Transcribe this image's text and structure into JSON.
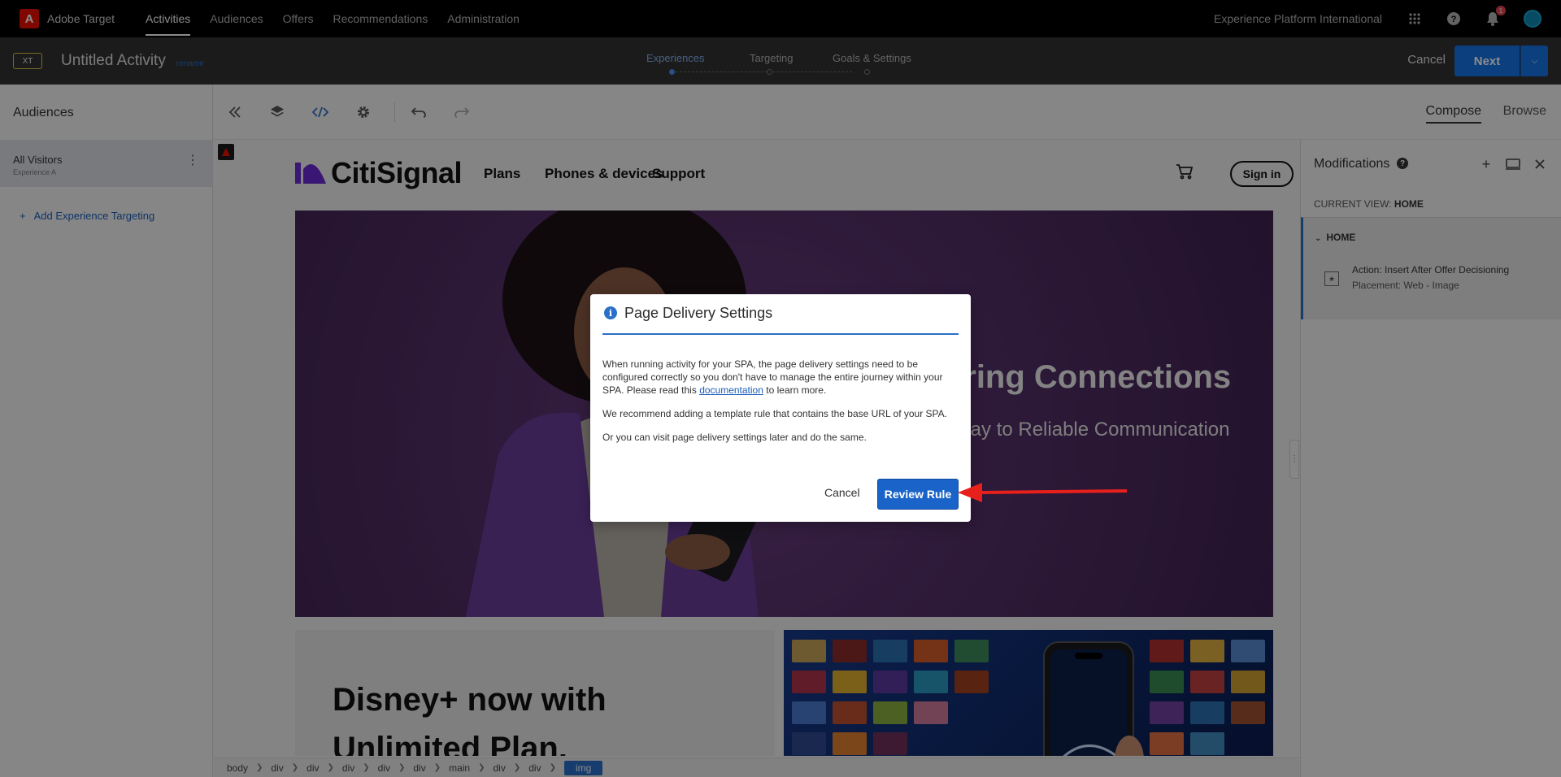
{
  "topnav": {
    "brand": "Adobe Target",
    "logo_letter": "A",
    "links": [
      "Activities",
      "Audiences",
      "Offers",
      "Recommendations",
      "Administration"
    ],
    "active_link": "Activities",
    "org": "Experience Platform International",
    "notification_count": "1"
  },
  "activity": {
    "badge": "XT",
    "title": "Untitled Activity",
    "rename": "rename",
    "steps": [
      "Experiences",
      "Targeting",
      "Goals & Settings"
    ],
    "active_step": "Experiences",
    "cancel_label": "Cancel",
    "next_label": "Next"
  },
  "left_panel": {
    "title": "Audiences",
    "audience_name": "All Visitors",
    "experience": "Experience A",
    "add_targeting": "Add Experience Targeting"
  },
  "toolbar": {
    "compose": "Compose",
    "browse": "Browse"
  },
  "site": {
    "logo": "CitiSignal",
    "nav": [
      "Plans",
      "Phones & devices",
      "Support"
    ],
    "signin": "Sign in",
    "hero_heading": "ering Connections",
    "hero_sub": "away to Reliable Communication",
    "promo_line1": "Disney+ now with",
    "promo_line2": "Unlimited Plan."
  },
  "right_panel": {
    "title": "Modifications",
    "current_view_label": "CURRENT VIEW:",
    "current_view": "HOME",
    "group": "HOME",
    "mod_action": "Action: Insert After Offer Decisioning",
    "mod_placement": "Placement: Web - Image"
  },
  "breadcrumb": [
    "body",
    "div",
    "div",
    "div",
    "div",
    "div",
    "main",
    "div",
    "div",
    "img"
  ],
  "dialog": {
    "title": "Page Delivery Settings",
    "para1_before": "When running activity for your SPA, the page delivery settings need to be configured correctly so you don't have to manage the entire journey within your SPA. Please read this ",
    "para1_link": "documentation",
    "para1_after": " to learn more.",
    "para2": "We recommend adding a template rule that contains the base URL of your SPA.",
    "para3": "Or you can visit page delivery settings later and do the same.",
    "cancel": "Cancel",
    "review": "Review Rule"
  },
  "colors": {
    "accent": "#1473e6",
    "dialog_button": "#1a64c9",
    "arrow": "#e8201c",
    "topnav": "#000000",
    "actbar": "#323232"
  }
}
